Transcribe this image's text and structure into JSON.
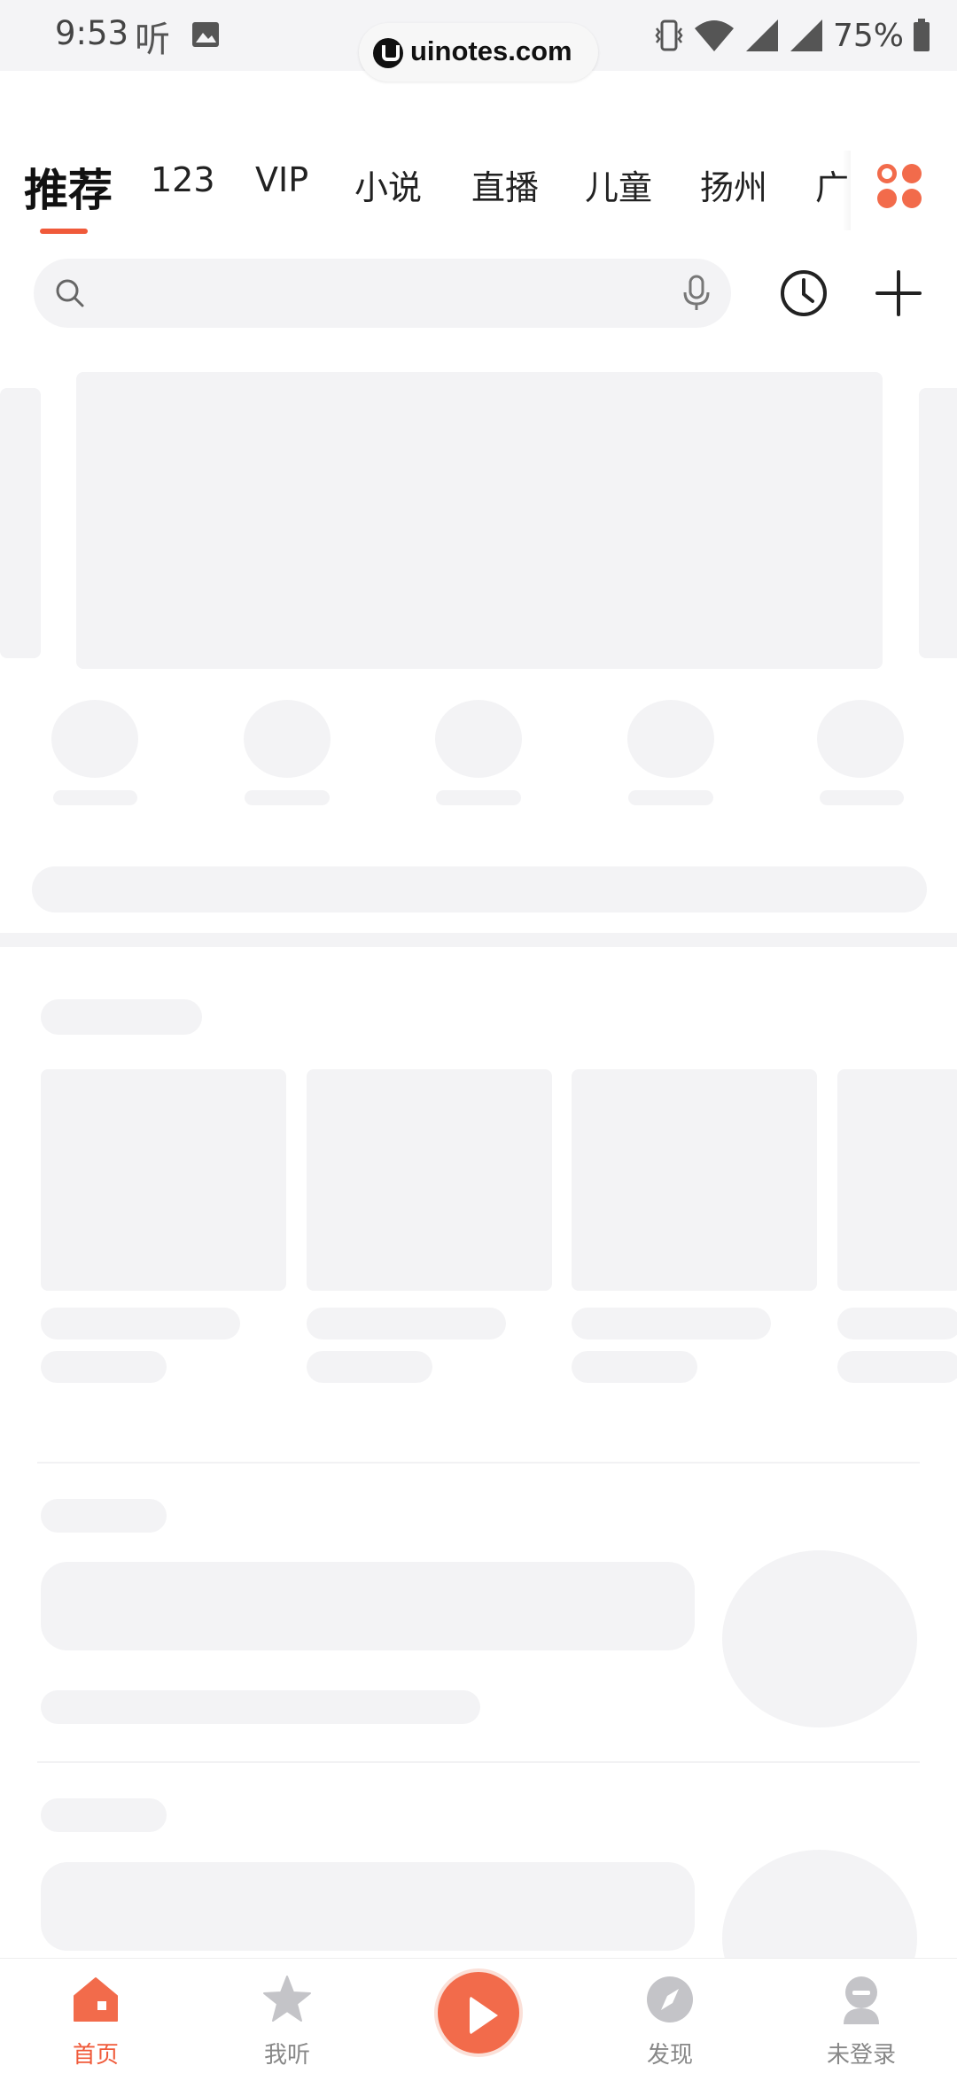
{
  "status_bar": {
    "time": "9:53",
    "app_glyph": "听",
    "site_badge": "uinotes.com",
    "battery": "75%"
  },
  "tabs": {
    "items": [
      {
        "label": "推荐",
        "active": true
      },
      {
        "label": "123"
      },
      {
        "label": "VIP"
      },
      {
        "label": "小说"
      },
      {
        "label": "直播"
      },
      {
        "label": "儿童"
      },
      {
        "label": "扬州"
      },
      {
        "label": "广"
      }
    ],
    "more_icon": "grid-dots-icon"
  },
  "search": {
    "placeholder": "",
    "search_icon": "search-icon",
    "voice_icon": "microphone-icon",
    "history_icon": "clock-icon",
    "add_icon": "plus-icon"
  },
  "bottom_nav": {
    "items": [
      {
        "label": "首页",
        "icon": "home-icon",
        "active": true
      },
      {
        "label": "我听",
        "icon": "star-icon"
      },
      {
        "label": "",
        "icon": "play-icon"
      },
      {
        "label": "发现",
        "icon": "compass-icon"
      },
      {
        "label": "未登录",
        "icon": "user-icon"
      }
    ]
  },
  "colors": {
    "accent": "#f05a3a",
    "skeleton": "#f3f3f5",
    "inactive_text": "#888888"
  }
}
